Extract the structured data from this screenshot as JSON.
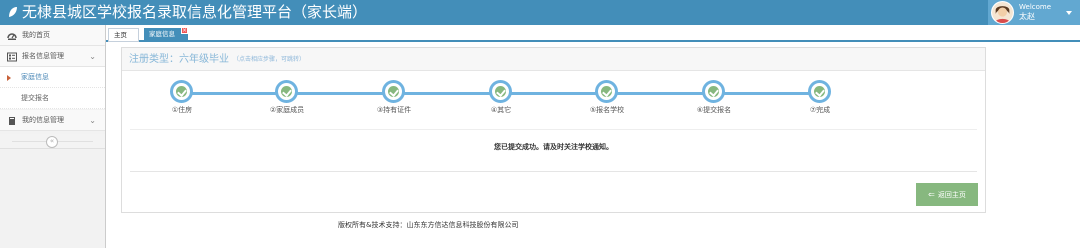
{
  "header": {
    "title": "无棣县城区学校报名录取信息化管理平台（家长端）",
    "welcome": "Welcome",
    "username": "太赵"
  },
  "sidebar": {
    "items": [
      {
        "label": "我的首页",
        "icon": "dashboard-icon"
      },
      {
        "label": "报名信息管理",
        "icon": "list-icon",
        "chevron": "⌄"
      },
      {
        "label": "家庭信息",
        "active": true
      },
      {
        "label": "提交报名"
      },
      {
        "label": "我的信息管理",
        "icon": "book-icon",
        "chevron": "⌄"
      }
    ],
    "collapse_glyph": "«"
  },
  "tabs": {
    "home": "主页",
    "active": "家庭信息",
    "close_glyph": "×"
  },
  "panel": {
    "title": "注册类型：六年级毕业",
    "hint": "（点击相应步骤，可跳转）",
    "steps": [
      "①住房",
      "②家庭成员",
      "③持有证件",
      "④其它",
      "⑤报名学校",
      "⑥提交报名",
      "⑦完成"
    ],
    "message": "您已提交成功。请及时关注学校通知。",
    "back_button": "返回主页"
  },
  "footer": {
    "text": "版权所有&技术支持：山东东方信达信息科技股份有限公司"
  },
  "colors": {
    "header_bg": "#438eb9",
    "step_border": "#6fb3e0",
    "check_green": "#87b87f",
    "button_green": "#87b87f"
  }
}
